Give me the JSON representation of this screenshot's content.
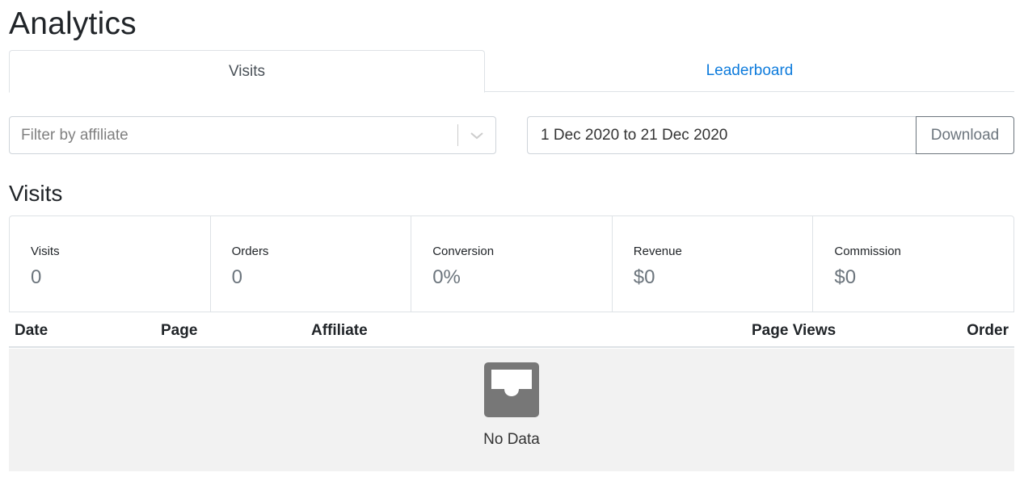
{
  "page": {
    "title": "Analytics"
  },
  "tabs": [
    {
      "label": "Visits",
      "active": true
    },
    {
      "label": "Leaderboard",
      "active": false
    }
  ],
  "filters": {
    "affiliate_placeholder": "Filter by affiliate",
    "date_range": "1 Dec 2020 to 21 Dec 2020",
    "download_label": "Download"
  },
  "visits": {
    "title": "Visits",
    "stats": [
      {
        "label": "Visits",
        "value": "0"
      },
      {
        "label": "Orders",
        "value": "0"
      },
      {
        "label": "Conversion",
        "value": "0%"
      },
      {
        "label": "Revenue",
        "value": "$0"
      },
      {
        "label": "Commission",
        "value": "$0"
      }
    ]
  },
  "table": {
    "columns": [
      "Date",
      "Page",
      "Affiliate",
      "Page Views",
      "Order"
    ],
    "empty_text": "No Data",
    "empty_icon": "inbox-icon"
  },
  "colors": {
    "link": "#0d7bdc",
    "empty_bg": "#f2f2f2",
    "icon": "#777777"
  }
}
